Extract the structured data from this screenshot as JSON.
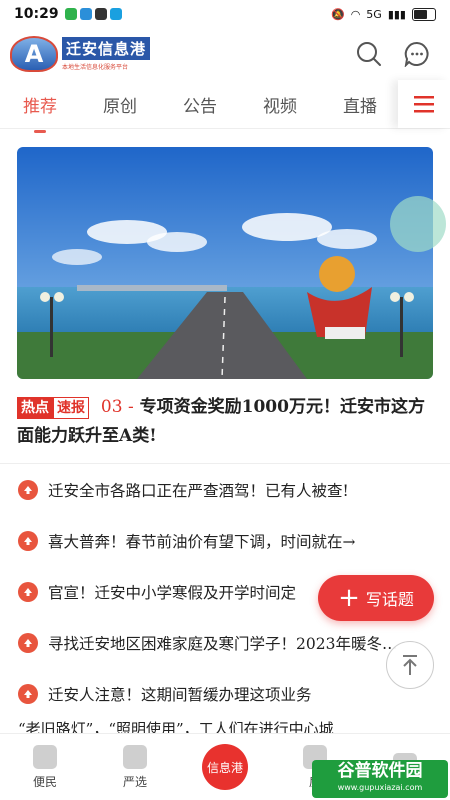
{
  "status_bar": {
    "time": "10:29",
    "network": "5G"
  },
  "header": {
    "logo_letter": "A",
    "logo_title": "迁安信息港",
    "logo_subtitle": "本地生活信息化服务平台"
  },
  "tabs": [
    {
      "label": "推荐",
      "active": true
    },
    {
      "label": "原创"
    },
    {
      "label": "公告"
    },
    {
      "label": "视频"
    },
    {
      "label": "直播"
    }
  ],
  "headline": {
    "tag_hot": "热点",
    "tag_fast": "速报",
    "index": "03 -",
    "title": "专项资金奖励1000万元！迁安市这方面能力跃升至A类!"
  },
  "news": [
    {
      "title": "迁安全市各路口正在严查酒驾！已有人被查!"
    },
    {
      "title": "喜大普奔！春节前油价有望下调，时间就在→"
    },
    {
      "title": "官宣！迁安中小学寒假及开学时间定"
    },
    {
      "title": "寻找迁安地区困难家庭及寒门学子！2023年暖冬…"
    },
    {
      "title": "迁安人注意！这期间暂缓办理这项业务"
    }
  ],
  "peek_text": "“老旧路灯”，“照明使用”，工人们在进行中心城",
  "write_button": {
    "label": "写话题"
  },
  "bottom_nav": [
    {
      "label": "便民"
    },
    {
      "label": "严选"
    },
    {
      "label": "信息港",
      "center": true
    },
    {
      "label": "房"
    },
    {
      "label": ""
    }
  ],
  "watermark": {
    "main": "谷普软件园",
    "sub": "www.gupuxiazai.com"
  },
  "colors": {
    "accent": "#e8322e",
    "brand_blue": "#2a57a8"
  }
}
